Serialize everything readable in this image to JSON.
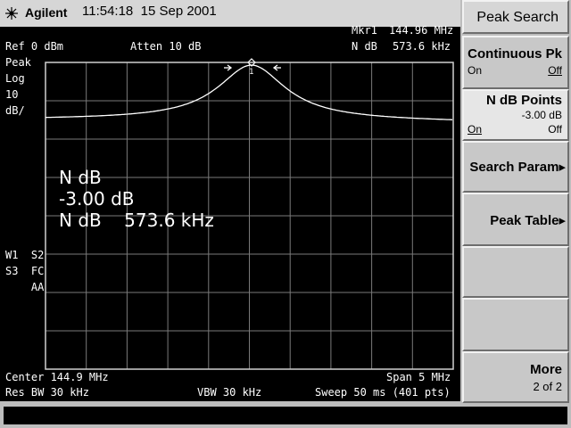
{
  "header": {
    "brand": "Agilent",
    "time": "11:54:18",
    "date": "15 Sep 2001"
  },
  "screen": {
    "mkr_label": "Mkr1",
    "mkr_freq": "144.96 MHz",
    "ref_level": "Ref 0 dBm",
    "atten": "Atten 10 dB",
    "ndb_label_top": "N dB",
    "ndb_value_top": "573.6 kHz",
    "left_ann": [
      "Peak",
      "Log",
      "10",
      "dB/"
    ],
    "left_ann2": [
      "W1  S2",
      "S3  FC",
      "    AA"
    ],
    "marker_number": "1",
    "readout": {
      "line1": "N dB",
      "line2": "-3.00 dB",
      "line3": "N dB    573.6 kHz"
    },
    "center": "Center 144.9 MHz",
    "span": "Span 5 MHz",
    "res_bw": "Res BW 30 kHz",
    "vbw": "VBW 30 kHz",
    "sweep": "Sweep 50 ms (401 pts)"
  },
  "softkeys": {
    "title": "Peak Search",
    "continuous": {
      "label": "Continuous Pk",
      "on": "On",
      "off": "Off"
    },
    "ndb_points": {
      "label": "N dB Points",
      "value": "-3.00 dB",
      "on": "On",
      "off": "Off"
    },
    "search_param": "Search Param",
    "peak_table": "Peak Table",
    "more": "More",
    "page": "2 of 2"
  },
  "arrow_glyph": "▸",
  "colors": {
    "trace": "#ffffff",
    "grid": "#7a7a7a",
    "screen_bg": "#000000"
  }
}
